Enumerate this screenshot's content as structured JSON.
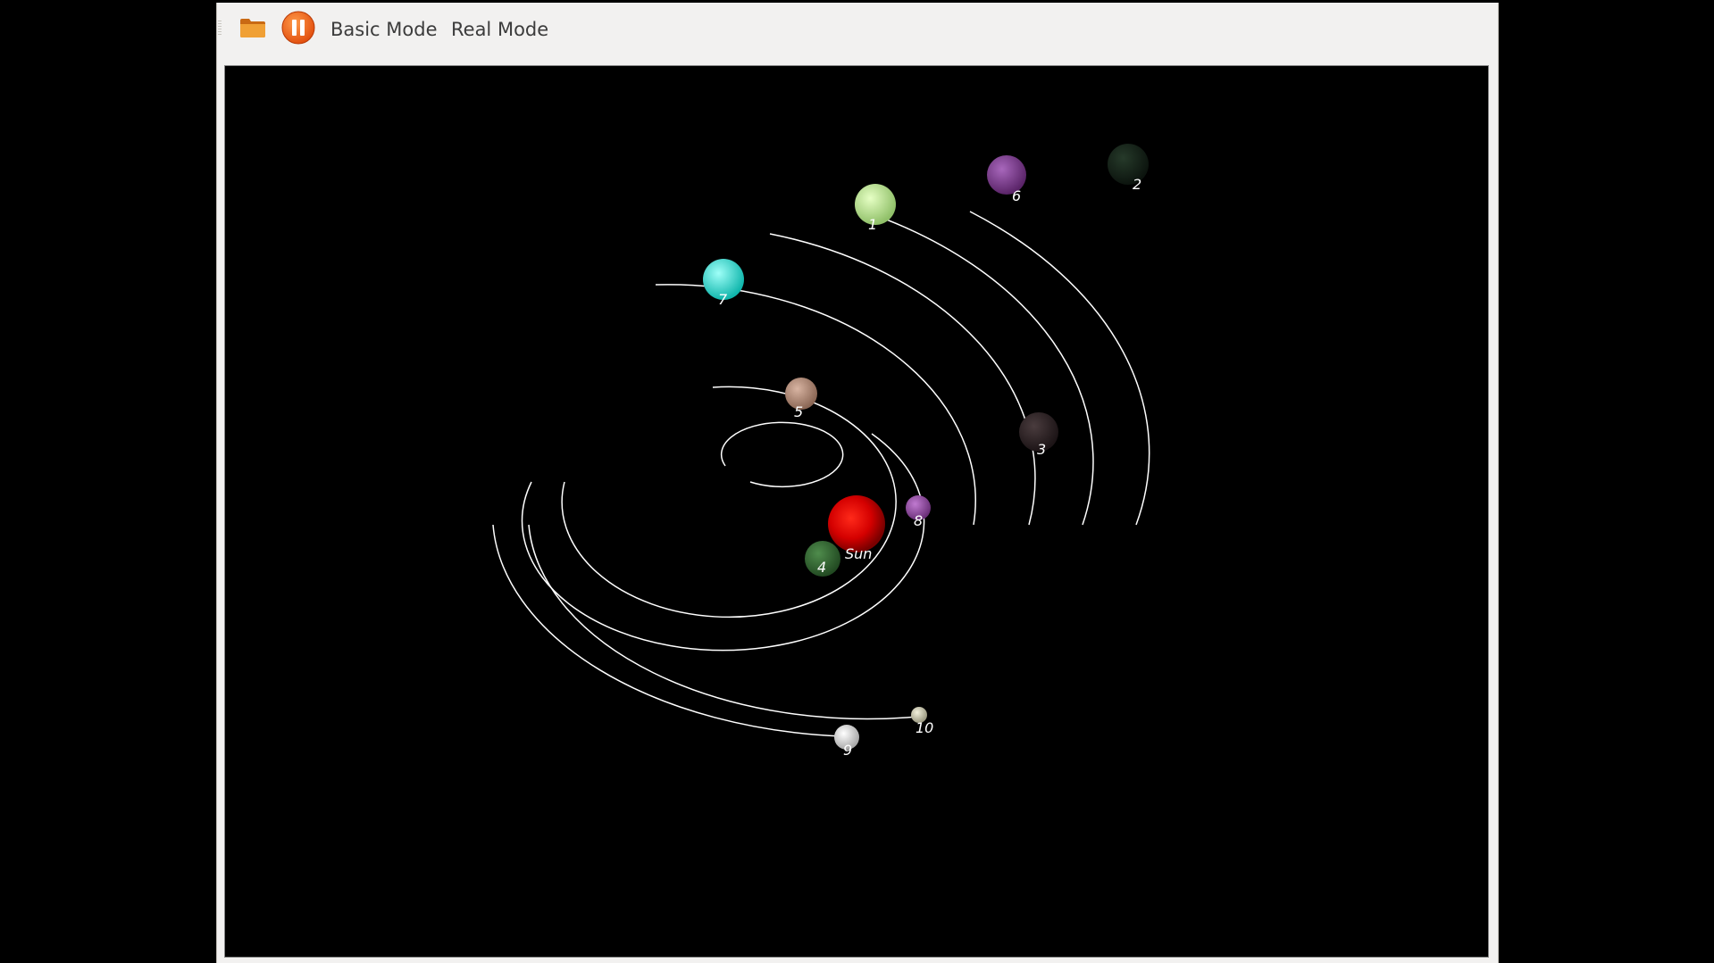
{
  "toolbar": {
    "open_icon": "folder-icon",
    "pause_icon": "pause-icon",
    "basic_mode_label": "Basic Mode",
    "real_mode_label": "Real Mode"
  },
  "scene": {
    "background": "#000000",
    "orbit_color": "#ffffff",
    "sun": {
      "label": "Sun",
      "color": "#d40000"
    },
    "planets": [
      {
        "label": "1",
        "color": "#b8df8e"
      },
      {
        "label": "2",
        "color": "#162219"
      },
      {
        "label": "3",
        "color": "#2e2426"
      },
      {
        "label": "4",
        "color": "#356b34"
      },
      {
        "label": "5",
        "color": "#b08a78"
      },
      {
        "label": "6",
        "color": "#7e3f90"
      },
      {
        "label": "7",
        "color": "#2ee0d6"
      },
      {
        "label": "8",
        "color": "#8e4a9a"
      },
      {
        "label": "9",
        "color": "#d8d8d8"
      },
      {
        "label": "10",
        "color": "#c8c6b0"
      }
    ]
  }
}
